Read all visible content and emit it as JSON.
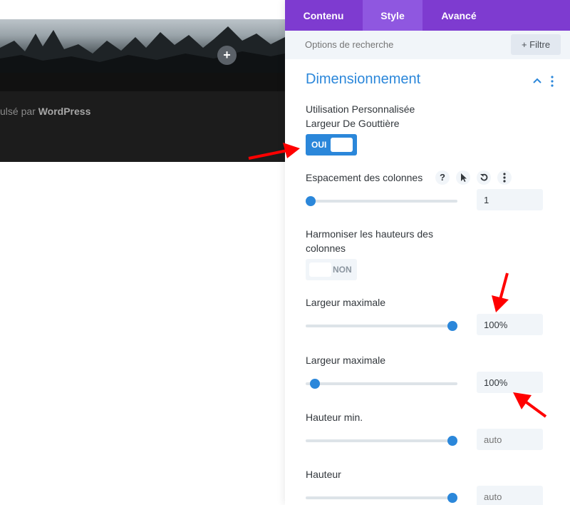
{
  "preview": {
    "add_symbol": "+",
    "footer_prefix": "ulsé par ",
    "footer_brand": "WordPress"
  },
  "panel": {
    "tabs": [
      {
        "label": "Contenu",
        "active": false
      },
      {
        "label": "Style",
        "active": true
      },
      {
        "label": "Avancé",
        "active": false
      }
    ],
    "search": {
      "placeholder": "Options de recherche"
    },
    "filter_label": "+ Filtre",
    "section": {
      "title": "Dimensionnement"
    },
    "gutter": {
      "label_line1": "Utilisation Personnalisée",
      "label_line2": "Largeur De Gouttière",
      "toggle_label": "OUI",
      "state": true
    },
    "column_spacing": {
      "label": "Espacement des colonnes",
      "help_icon": "?",
      "value": "1",
      "slider_level": 0.0
    },
    "equalize": {
      "label_line1": "Harmoniser les hauteurs des",
      "label_line2": "colonnes",
      "toggle_label": "NON",
      "state": false
    },
    "max_width_1": {
      "label": "Largeur maximale",
      "value": "100%",
      "slider_level": 1.0
    },
    "max_width_2": {
      "label": "Largeur maximale",
      "value": "100%",
      "slider_level": 0.03
    },
    "min_height": {
      "label": "Hauteur min.",
      "placeholder": "auto",
      "slider_level": 1.0
    },
    "height": {
      "label": "Hauteur",
      "placeholder": "auto",
      "slider_level": 1.0
    }
  },
  "colors": {
    "tabs_bg": "#7e3bd0",
    "active_tab_bg": "#8f57e0",
    "accent_blue": "#2b87da",
    "annotation_red": "#ff0000"
  }
}
